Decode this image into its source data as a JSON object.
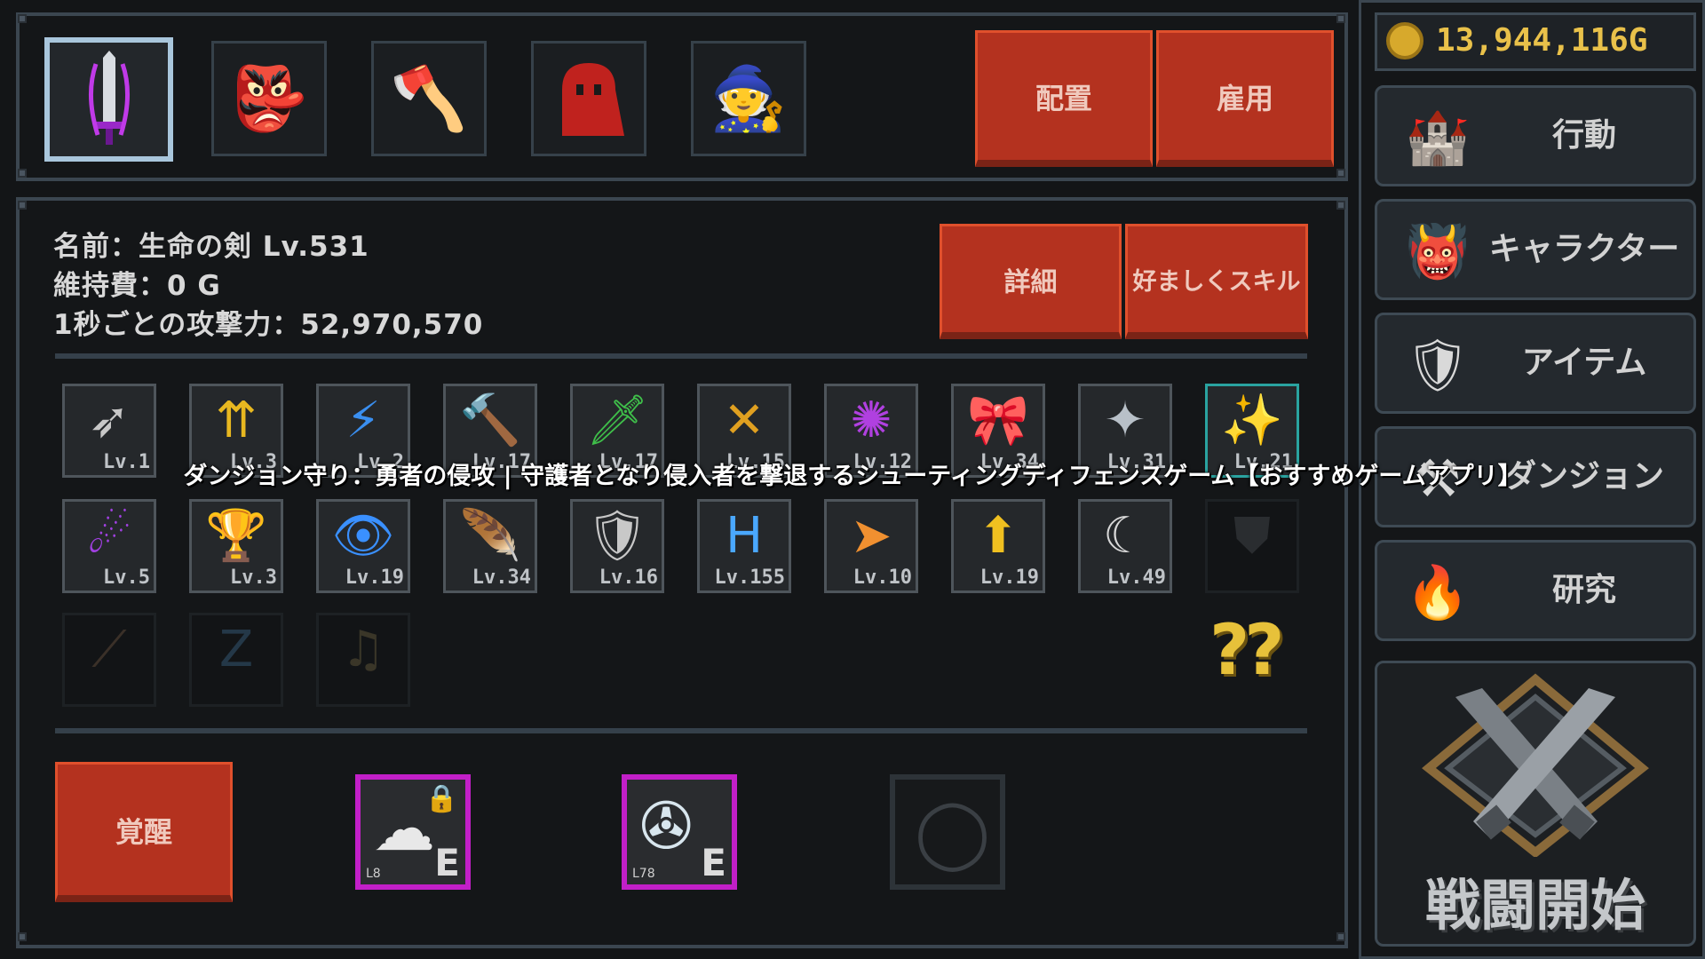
{
  "top_party": {
    "slots": [
      {
        "name": "purple-sword",
        "icon": "🗡"
      },
      {
        "name": "red-goblin",
        "icon": "👺"
      },
      {
        "name": "axe-warrior",
        "icon": "🪓"
      },
      {
        "name": "red-slime",
        "icon": "👻"
      },
      {
        "name": "wizard",
        "icon": "🧙"
      }
    ],
    "deploy_label": "配置",
    "hire_label": "雇用"
  },
  "info": {
    "name_line": "名前：生命の剣 Lv.531",
    "upkeep_line": "維持費：0 G",
    "attack_line": "1秒ごとの攻撃力：52,970,570",
    "detail_label": "詳細",
    "pref_skill_label": "好ましくスキル"
  },
  "skills_row1": [
    {
      "icon": "arrow-icon",
      "glyph": "➶",
      "level": "Lv.1",
      "color": "#c8c8c8"
    },
    {
      "icon": "double-up-arrow-icon",
      "glyph": "⇈",
      "level": "Lv.3",
      "color": "#e8b820"
    },
    {
      "icon": "blue-slash-icon",
      "glyph": "⚡",
      "level": "Lv.2",
      "color": "#3a8ff0"
    },
    {
      "icon": "hammer-icon",
      "glyph": "🔨",
      "level": "Lv.17",
      "color": "#9aa0a6"
    },
    {
      "icon": "green-blade-icon",
      "glyph": "🗡",
      "level": "Lv.17",
      "color": "#3fbf4a"
    },
    {
      "icon": "lightning-cross-icon",
      "glyph": "✕",
      "level": "Lv.15",
      "color": "#e0a020"
    },
    {
      "icon": "purple-burst-icon",
      "glyph": "✺",
      "level": "Lv.12",
      "color": "#b040e0"
    },
    {
      "icon": "ribbon-icon",
      "glyph": "🎀",
      "level": "Lv.34",
      "color": "#e05040"
    },
    {
      "icon": "shuriken-icon",
      "glyph": "✦",
      "level": "Lv.31",
      "color": "#b8c0c8"
    },
    {
      "icon": "stars-icon",
      "glyph": "✨",
      "level": "Lv.21",
      "color": "#f0e070"
    }
  ],
  "skills_row2": [
    {
      "icon": "purple-streak-icon",
      "glyph": "☄",
      "level": "Lv.5",
      "color": "#a040e0"
    },
    {
      "icon": "chalice-icon",
      "glyph": "🏆",
      "level": "Lv.3",
      "color": "#e0a060"
    },
    {
      "icon": "blue-eye-icon",
      "glyph": "👁",
      "level": "Lv.19",
      "color": "#3a90ff"
    },
    {
      "icon": "golden-feather-icon",
      "glyph": "🪶",
      "level": "Lv.34",
      "color": "#f0c040"
    },
    {
      "icon": "broken-shield-icon",
      "glyph": "🛡",
      "level": "Lv.16",
      "color": "#c8c8c8"
    },
    {
      "icon": "blue-rune-icon",
      "glyph": "H",
      "level": "Lv.155",
      "color": "#4aa8ff"
    },
    {
      "icon": "fire-arrow-icon",
      "glyph": "➤",
      "level": "Lv.10",
      "color": "#f09030"
    },
    {
      "icon": "yellow-up-arrow-icon",
      "glyph": "⬆",
      "level": "Lv.19",
      "color": "#f0c020"
    },
    {
      "icon": "crescent-icon",
      "glyph": "☾",
      "level": "Lv.49",
      "color": "#d8d8d8"
    },
    {
      "icon": "locked-shield-icon",
      "glyph": "⛊",
      "level": "",
      "color": "#2a2d30"
    }
  ],
  "skills_row3": [
    {
      "icon": "dim-claw-icon",
      "glyph": "⟋",
      "color": "#3a3028"
    },
    {
      "icon": "dim-z-icon",
      "glyph": "Z",
      "color": "#243848"
    },
    {
      "icon": "dim-note-icon",
      "glyph": "♫",
      "color": "#3a3628"
    }
  ],
  "question_marks": "??",
  "awaken_label": "覚醒",
  "equip_skills": [
    {
      "name": "cloud-lock",
      "glyph": "☁",
      "letter": "E",
      "level": "L8"
    },
    {
      "name": "spin-blade",
      "glyph": "✇",
      "letter": "E",
      "level": "L78"
    }
  ],
  "gold": {
    "amount": "13,944,116G"
  },
  "side_menu": [
    {
      "name": "action",
      "label": "行動",
      "glyph": "🏰"
    },
    {
      "name": "character",
      "label": "キャラクター",
      "glyph": "👹"
    },
    {
      "name": "item",
      "label": "アイテム",
      "glyph": "🛡"
    },
    {
      "name": "dungeon",
      "label": "ダンジョン",
      "glyph": "⚒"
    },
    {
      "name": "research",
      "label": "研究",
      "glyph": "🔥"
    }
  ],
  "battle_start_label": "戦闘開始",
  "overlay_title": "ダンジョン守り：勇者の侵攻 | 守護者となり侵入者を撃退するシューティングディフェンスゲーム【おすすめゲームアプリ】",
  "colors": {
    "button_red": "#b4321f",
    "gold_text": "#e9c14a",
    "skill_border": "#c21fc8"
  }
}
